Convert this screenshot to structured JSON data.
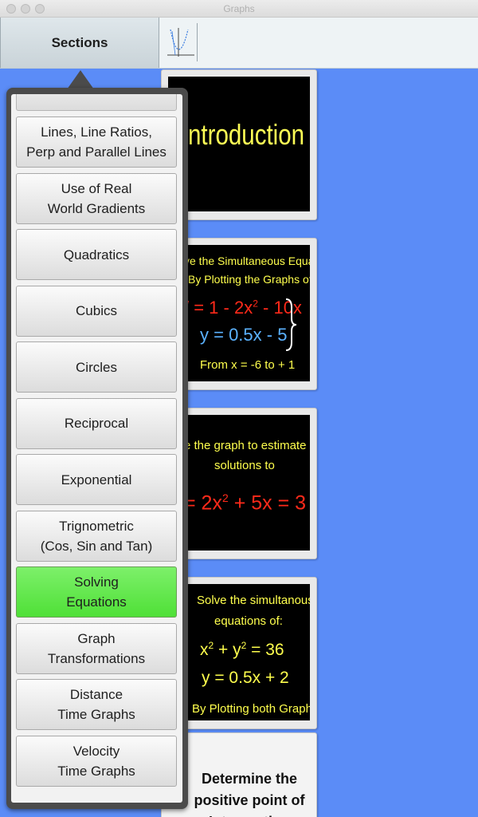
{
  "window": {
    "title": "Graphs"
  },
  "toolbar": {
    "sections_label": "Sections"
  },
  "sections": [
    {
      "label": "Lines, Line Ratios,\nPerp and Parallel Lines",
      "selected": false
    },
    {
      "label": "Use of Real\nWorld Gradients",
      "selected": false
    },
    {
      "label": "Quadratics",
      "selected": false
    },
    {
      "label": "Cubics",
      "selected": false
    },
    {
      "label": "Circles",
      "selected": false
    },
    {
      "label": "Reciprocal",
      "selected": false
    },
    {
      "label": "Exponential",
      "selected": false
    },
    {
      "label": "Trignometric\n(Cos, Sin and Tan)",
      "selected": false
    },
    {
      "label": "Solving\nEquations",
      "selected": true
    },
    {
      "label": "Graph\nTransformations",
      "selected": false
    },
    {
      "label": "Distance\nTime Graphs",
      "selected": false
    },
    {
      "label": "Velocity\nTime Graphs",
      "selected": false
    }
  ],
  "cards": {
    "intro": "ntroduction",
    "simultaneous": {
      "line1": "ve the Simultaneous Equations",
      "line2": "By Plotting the Graphs of:",
      "eq1a": "/ = 1 - 2x",
      "eq1sup": "2",
      "eq1b": " - 10x",
      "eq2": "y = 0.5x - 5",
      "range": "From x = -6 to + 1"
    },
    "estimate": {
      "line1": "e the graph to estimate both",
      "line2": "solutions to",
      "eqa": "= 2x",
      "eqsup": "2",
      "eqb": " + 5x = 3"
    },
    "circle": {
      "line1": "Solve the simultanous",
      "line2": "equations of:",
      "eq1a": "x",
      "eq1sup1": "2",
      "eq1b": " + y",
      "eq1sup2": "2",
      "eq1c": " = 36",
      "eq2": "y = 0.5x + 2",
      "line3": "By Plotting both Graphs"
    },
    "positive_point": "Determine the positive point of Intersection"
  },
  "colors": {
    "background": "#5b8cf7",
    "selected": "#5ae443",
    "card_text_yellow": "#ffff4d",
    "card_text_red": "#ff2a1a",
    "card_text_blue": "#5bb2ff"
  }
}
